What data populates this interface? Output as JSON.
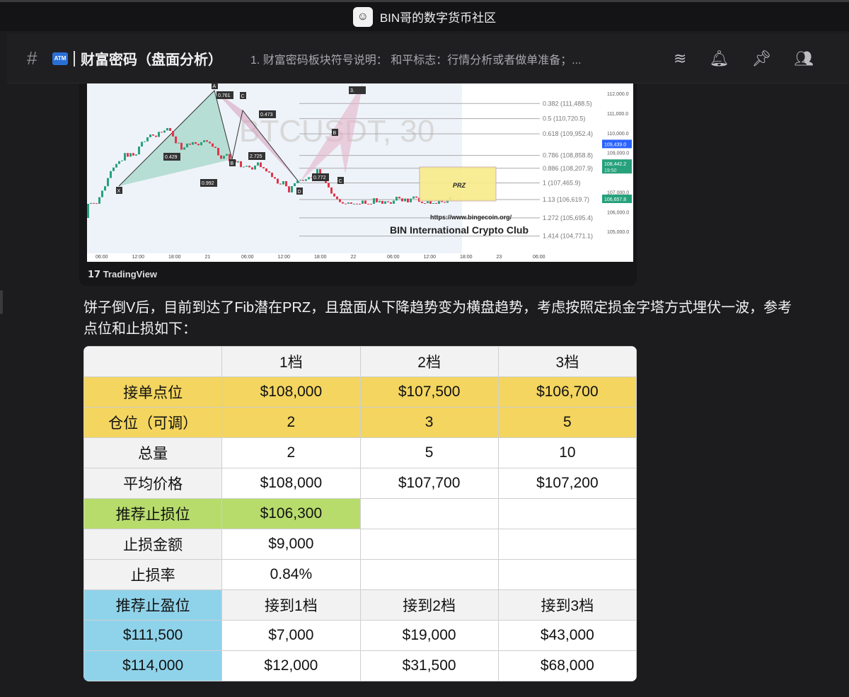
{
  "app": {
    "title": "BIN哥的数字货币社区"
  },
  "header": {
    "channel": "财富密码（盘面分析）",
    "topic": "1. 财富密码板块符号说明： 和平标志：行情分析或者做单准备；...",
    "atm": "ATM"
  },
  "chart": {
    "symbol": "BTCUSDT, 30",
    "fib": [
      {
        "label": "0.382 (111,488.5)",
        "v": 111488.5
      },
      {
        "label": "0.5 (110,720.5)",
        "v": 110720.5
      },
      {
        "label": "0.618 (109,952.4)",
        "v": 109952.4
      },
      {
        "label": "0.786 (108,858.8)",
        "v": 108858.8
      },
      {
        "label": "0.886 (108,207.9)",
        "v": 108207.9
      },
      {
        "label": "1 (107,465.9)",
        "v": 107465.9
      },
      {
        "label": "1.13 (106,619.7)",
        "v": 106619.7
      },
      {
        "label": "1.272 (105,695.4)",
        "v": 105695.4
      },
      {
        "label": "1.414 (104,771.1)",
        "v": 104771.1
      }
    ],
    "price_ticks": [
      "112,000.0",
      "111,000.0",
      "110,000.0",
      "109,000.0",
      "107,000.0",
      "106,000.0",
      "105,000.0"
    ],
    "badges": [
      {
        "text": "109,439.0",
        "color": "#2962ff",
        "v": 109439
      },
      {
        "text": "108,442.2",
        "color": "#26a17b",
        "v": 108442.2
      },
      {
        "text": "106,657.8",
        "color": "#26a17b",
        "v": 106657.8
      }
    ],
    "countdown": "19:50",
    "time_ticks": [
      "06:00",
      "12:00",
      "18:00",
      "21",
      "06:00",
      "12:00",
      "18:00",
      "22",
      "06:00",
      "12:00",
      "18:00",
      "23",
      "06:00"
    ],
    "ratios": [
      "0.761",
      "0.473",
      "0.429",
      "2.725",
      "0.992",
      "0.772",
      "3."
    ],
    "points": [
      "X",
      "A",
      "B",
      "C",
      "D",
      "B",
      "C"
    ],
    "prz": "PRZ",
    "url": "https://www.bingecoin.org/",
    "club": "BIN International Crypto Club",
    "brand": "TradingView"
  },
  "message": "饼子倒V后，目前到达了Fib潜在PRZ，且盘面从下降趋势变为横盘趋势，考虑按照定损金字塔方式埋伏一波，参考点位和止损如下：",
  "table": {
    "header": [
      "",
      "1档",
      "2档",
      "3档"
    ],
    "rows": [
      [
        "接单点位",
        "$108,000",
        "$107,500",
        "$106,700"
      ],
      [
        "仓位（可调）",
        "2",
        "3",
        "5"
      ],
      [
        "总量",
        "2",
        "5",
        "10"
      ],
      [
        "平均价格",
        "$108,000",
        "$107,700",
        "$107,200"
      ],
      [
        "推荐止损位",
        "$106,300",
        "",
        ""
      ],
      [
        "止损金额",
        "$9,000",
        "",
        ""
      ],
      [
        "止损率",
        "0.84%",
        "",
        ""
      ],
      [
        "推荐止盈位",
        "接到1档",
        "接到2档",
        "接到3档"
      ],
      [
        "$111,500",
        "$7,000",
        "$19,000",
        "$43,000"
      ],
      [
        "$114,000",
        "$12,000",
        "$31,500",
        "$68,000"
      ]
    ]
  }
}
